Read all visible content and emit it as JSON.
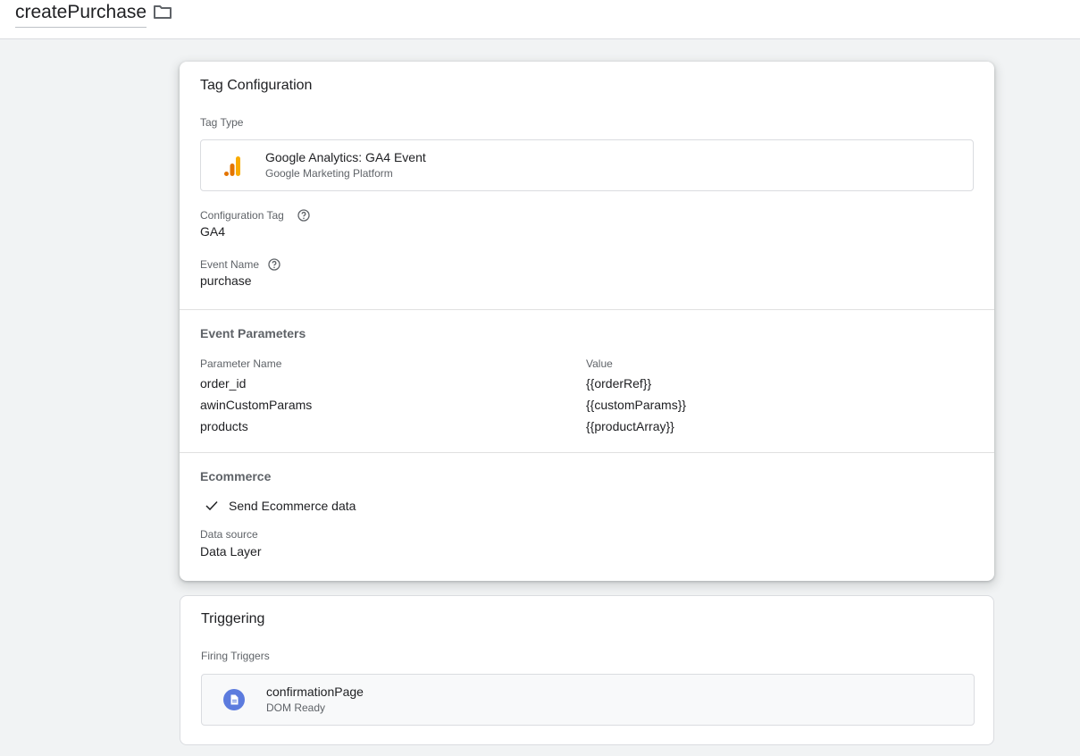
{
  "header": {
    "tag_name": "createPurchase",
    "folder_icon": "folder-icon"
  },
  "tag_configuration": {
    "title": "Tag Configuration",
    "tag_type_label": "Tag Type",
    "tag_type": {
      "name": "Google Analytics: GA4 Event",
      "provider": "Google Marketing Platform",
      "icon": "google-analytics-icon",
      "icon_colors": [
        "#e37400",
        "#f9ab00"
      ]
    },
    "configuration_tag_label": "Configuration Tag",
    "configuration_tag_value": "GA4",
    "event_name_label": "Event Name",
    "event_name_value": "purchase",
    "event_parameters": {
      "title": "Event Parameters",
      "col_name": "Parameter Name",
      "col_value": "Value",
      "rows": [
        {
          "name": "order_id",
          "value": "{{orderRef}}"
        },
        {
          "name": "awinCustomParams",
          "value": "{{customParams}}"
        },
        {
          "name": "products",
          "value": "{{productArray}}"
        }
      ]
    },
    "ecommerce": {
      "title": "Ecommerce",
      "send_label": "Send Ecommerce data",
      "data_source_label": "Data source",
      "data_source_value": "Data Layer"
    }
  },
  "triggering": {
    "title": "Triggering",
    "firing_label": "Firing Triggers",
    "trigger": {
      "name": "confirmationPage",
      "type": "DOM Ready",
      "icon": "page-document-icon",
      "icon_color": "#5c7bde"
    }
  }
}
